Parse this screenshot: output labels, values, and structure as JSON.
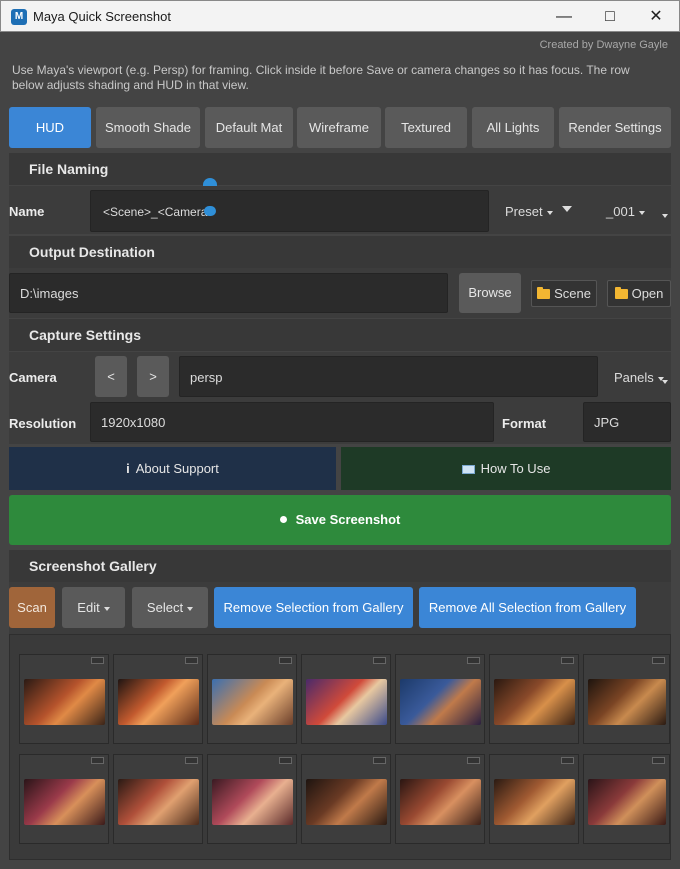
{
  "window": {
    "title": "Maya Quick Screenshot",
    "app_icon": "maya-app-icon",
    "controls": [
      "minimize-icon",
      "maximize-icon",
      "close-icon"
    ]
  },
  "credit": "Created by Dwayne Gayle",
  "help_text": "Use Maya's viewport (e.g. Persp) for framing. Click inside it before Save or camera changes so it has focus. The row below adjusts shading and HUD in that view.",
  "viewport_buttons": [
    "HUD",
    "Smooth Shade",
    "Default Mat",
    "Wireframe",
    "Textured",
    "All Lights",
    "Render Settings"
  ],
  "file_naming": {
    "header": "File Naming",
    "name_label": "Name",
    "name_value": "<Scene>_<Camera>",
    "preset_label": "Preset",
    "suffix_label": "_001"
  },
  "output": {
    "header": "Output Destination",
    "path": "D:\\images",
    "browse_label": "Browse",
    "scene_label": "Scene",
    "open_label": "Open"
  },
  "capture": {
    "header": "Capture Settings",
    "camera_label": "Camera",
    "prev_label": "<",
    "next_label": ">",
    "camera_value": "persp",
    "panels_label": "Panels",
    "resolution_label": "Resolution",
    "resolution_value": "1920x1080",
    "format_label": "Format",
    "format_value": "JPG"
  },
  "about_label": "About  Support",
  "howto_label": "How To Use",
  "save_label": "Save Screenshot",
  "gallery": {
    "header": "Screenshot Gallery",
    "scan_label": "Scan",
    "edit_label": "Edit",
    "select_label": "Select",
    "remove_sel_label": "Remove Selection from Gallery",
    "remove_all_label": "Remove All Selection from Gallery"
  },
  "colors": {
    "accent_blue": "#3b86d6",
    "save_green": "#2e8a3c",
    "scan_brown": "#a0653a",
    "about_navy": "#1f3048",
    "howto_green": "#1e3a26"
  }
}
